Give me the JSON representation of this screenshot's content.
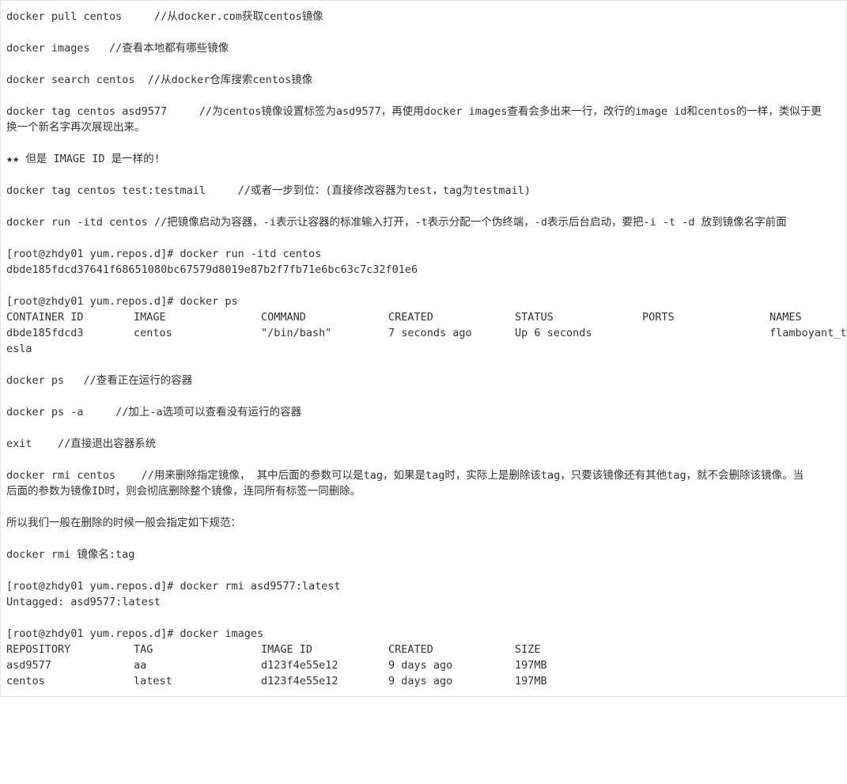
{
  "lines": {
    "l1": "docker pull centos     //从docker.com获取centos镜像",
    "l2": "docker images   //查看本地都有哪些镜像",
    "l3": "docker search centos  //从docker仓库搜索centos镜像",
    "l4a": "docker tag centos asd9577     //为centos镜像设置标签为asd9577，再使用docker images查看会多出来一行，改行的image id和centos的一样，类似于更",
    "l4b": "换一个新名字再次展现出来。",
    "l5_stars": "★★",
    "l5": " 但是 IMAGE ID 是一样的!",
    "l6": "docker tag centos test:testmail     //或者一步到位：(直接修改容器为test，tag为testmail)",
    "l7": "docker run -itd centos //把镜像启动为容器，-i表示让容器的标准输入打开，-t表示分配一个伪终端，-d表示后台启动，要把-i -t -d 放到镜像名字前面",
    "l8": "[root@zhdy01 yum.repos.d]# docker run -itd centos",
    "l9": "dbde185fdcd37641f68651080bc67579d8019e87b2f7fb71e6bc63c7c32f01e6",
    "l10": "[root@zhdy01 yum.repos.d]# docker ps",
    "l11": "docker ps   //查看正在运行的容器",
    "l12": "docker ps -a     //加上-a选项可以查看没有运行的容器",
    "l13": "exit    //直接退出容器系统",
    "l14a": "docker rmi centos    //用来删除指定镜像， 其中后面的参数可以是tag，如果是tag时，实际上是删除该tag，只要该镜像还有其他tag，就不会删除该镜像。当",
    "l14b": "后面的参数为镜像ID时，则会彻底删除整个镜像，连同所有标签一同删除。",
    "l15": "所以我们一般在删除的时候一般会指定如下规范：",
    "l16": "docker rmi 镜像名:tag",
    "l17": "[root@zhdy01 yum.repos.d]# docker rmi asd9577:latest",
    "l18": "Untagged: asd9577:latest",
    "l19": "[root@zhdy01 yum.repos.d]# docker images"
  },
  "ps_table": {
    "headers": [
      "CONTAINER ID",
      "IMAGE",
      "COMMAND",
      "CREATED",
      "STATUS",
      "PORTS",
      "NAMES"
    ],
    "row": [
      "dbde185fdcd3",
      "centos",
      "\"/bin/bash\"",
      "7 seconds ago",
      "Up 6 seconds",
      "",
      "flamboyant_t"
    ],
    "wrap": "esla"
  },
  "images_table": {
    "headers": [
      "REPOSITORY",
      "TAG",
      "IMAGE ID",
      "CREATED",
      "SIZE"
    ],
    "rows": [
      [
        "asd9577",
        "aa",
        "d123f4e55e12",
        "9 days ago",
        "197MB"
      ],
      [
        "centos",
        "latest",
        "d123f4e55e12",
        "9 days ago",
        "197MB"
      ]
    ]
  }
}
